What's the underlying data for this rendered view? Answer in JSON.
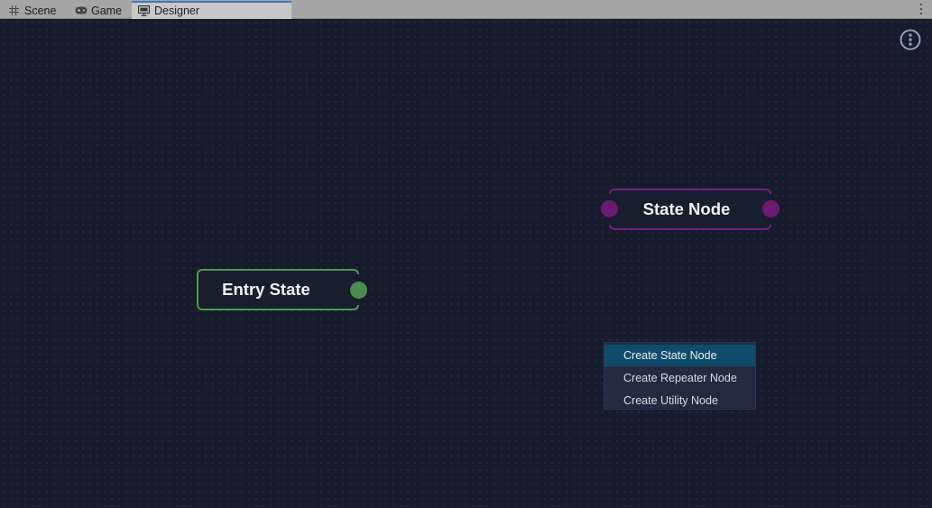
{
  "tabs": [
    {
      "label": "Scene",
      "icon": "grid-icon",
      "active": false
    },
    {
      "label": "Game",
      "icon": "gamepad-icon",
      "active": false
    },
    {
      "label": "Designer",
      "icon": "monitor-icon",
      "active": true
    }
  ],
  "canvas": {
    "options_icon": "vertical-ellipsis-circle-icon",
    "nodes": {
      "entry": {
        "label": "Entry State",
        "color": "#4f9a52"
      },
      "state": {
        "label": "State Node",
        "color": "#7b1e7e"
      }
    }
  },
  "context_menu": {
    "items": [
      {
        "label": "Create State Node",
        "highlighted": true
      },
      {
        "label": "Create Repeater Node",
        "highlighted": false
      },
      {
        "label": "Create Utility Node",
        "highlighted": false
      }
    ]
  },
  "colors": {
    "canvas_bg": "#161c2b",
    "tabbar_bg": "#a5a5a5",
    "active_tab_accent": "#3a79bb",
    "menu_highlight": "#0f4c6b"
  }
}
